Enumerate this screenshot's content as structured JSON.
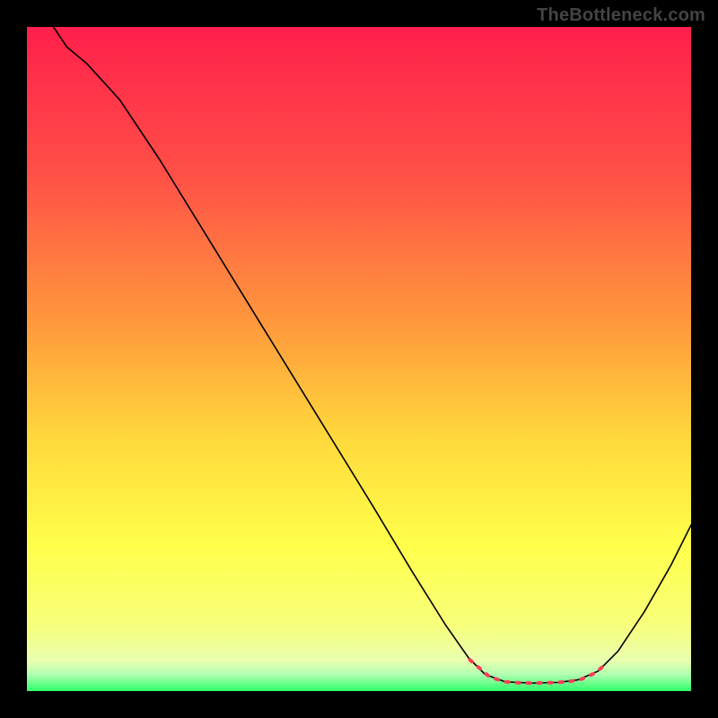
{
  "watermark": "TheBottleneck.com",
  "chart_data": {
    "type": "line",
    "title": "",
    "xlabel": "",
    "ylabel": "",
    "xlim": [
      0,
      100
    ],
    "ylim": [
      0,
      100
    ],
    "gradient_stops": [
      {
        "offset": 0.0,
        "color": "#ff1f4b"
      },
      {
        "offset": 0.22,
        "color": "#ff4f47"
      },
      {
        "offset": 0.45,
        "color": "#ff9a3c"
      },
      {
        "offset": 0.62,
        "color": "#ffd93c"
      },
      {
        "offset": 0.78,
        "color": "#ffff4a"
      },
      {
        "offset": 0.9,
        "color": "#f8ff7a"
      },
      {
        "offset": 0.955,
        "color": "#e8ffb0"
      },
      {
        "offset": 0.975,
        "color": "#b0ffb0"
      },
      {
        "offset": 1.0,
        "color": "#2eff6a"
      }
    ],
    "series": [
      {
        "name": "bottleneck-curve",
        "color": "#000000",
        "width": 1.6,
        "points": [
          {
            "x": 4.0,
            "y": 100.0
          },
          {
            "x": 6.0,
            "y": 97.0
          },
          {
            "x": 9.0,
            "y": 94.5
          },
          {
            "x": 14.0,
            "y": 89.0
          },
          {
            "x": 20.0,
            "y": 80.0
          },
          {
            "x": 28.0,
            "y": 67.0
          },
          {
            "x": 36.0,
            "y": 54.0
          },
          {
            "x": 44.0,
            "y": 41.0
          },
          {
            "x": 52.0,
            "y": 28.0
          },
          {
            "x": 58.0,
            "y": 18.0
          },
          {
            "x": 63.0,
            "y": 10.0
          },
          {
            "x": 66.5,
            "y": 5.0
          },
          {
            "x": 69.0,
            "y": 2.5
          },
          {
            "x": 72.0,
            "y": 1.4
          },
          {
            "x": 76.0,
            "y": 1.2
          },
          {
            "x": 80.0,
            "y": 1.3
          },
          {
            "x": 83.0,
            "y": 1.7
          },
          {
            "x": 86.0,
            "y": 3.0
          },
          {
            "x": 89.0,
            "y": 6.0
          },
          {
            "x": 93.0,
            "y": 12.0
          },
          {
            "x": 97.0,
            "y": 19.0
          },
          {
            "x": 100.0,
            "y": 25.0
          }
        ]
      }
    ],
    "annotations": {
      "dashed_segments": {
        "color": "#ff3e56",
        "stroke_width": 4.0,
        "dash": "3,9",
        "points": [
          {
            "x": 66.7,
            "y": 4.7
          },
          {
            "x": 69.7,
            "y": 2.1
          },
          {
            "x": 72.0,
            "y": 1.4
          },
          {
            "x": 74.0,
            "y": 1.25
          },
          {
            "x": 76.0,
            "y": 1.2
          },
          {
            "x": 78.0,
            "y": 1.25
          },
          {
            "x": 80.0,
            "y": 1.3
          },
          {
            "x": 82.0,
            "y": 1.5
          },
          {
            "x": 83.5,
            "y": 1.8
          },
          {
            "x": 85.5,
            "y": 2.7
          },
          {
            "x": 87.5,
            "y": 4.3
          }
        ]
      }
    }
  }
}
